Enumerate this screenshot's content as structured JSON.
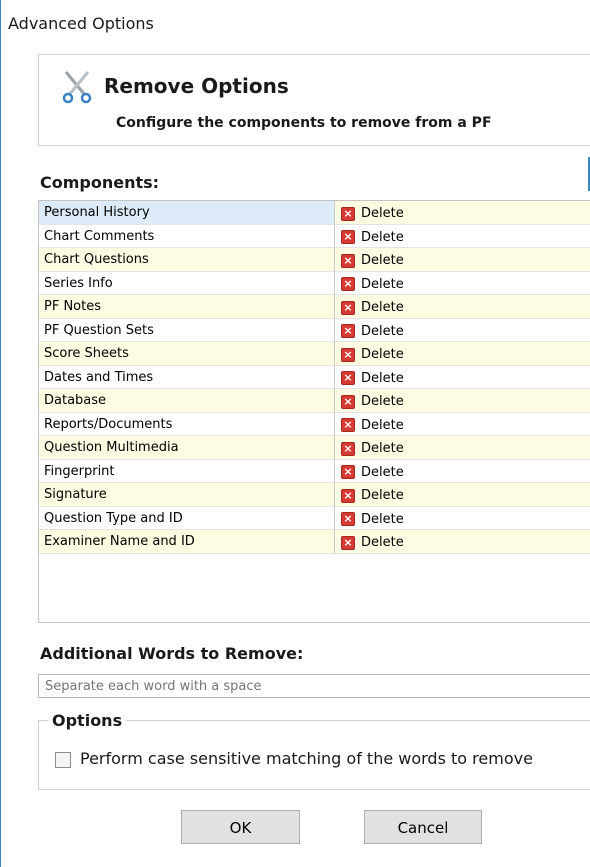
{
  "window": {
    "title": "Advanced Options"
  },
  "header": {
    "icon": "scissors-icon",
    "title": "Remove Options",
    "subtitle": "Configure the components to remove from a PF"
  },
  "components": {
    "heading": "Components:",
    "action_icon": "delete-x-icon",
    "items": [
      {
        "name": "Personal History",
        "action": "Delete"
      },
      {
        "name": "Chart Comments",
        "action": "Delete"
      },
      {
        "name": "Chart Questions",
        "action": "Delete"
      },
      {
        "name": "Series Info",
        "action": "Delete"
      },
      {
        "name": "PF Notes",
        "action": "Delete"
      },
      {
        "name": "PF Question Sets",
        "action": "Delete"
      },
      {
        "name": "Score Sheets",
        "action": "Delete"
      },
      {
        "name": "Dates and Times",
        "action": "Delete"
      },
      {
        "name": "Database",
        "action": "Delete"
      },
      {
        "name": "Reports/Documents",
        "action": "Delete"
      },
      {
        "name": "Question Multimedia",
        "action": "Delete"
      },
      {
        "name": "Fingerprint",
        "action": "Delete"
      },
      {
        "name": "Signature",
        "action": "Delete"
      },
      {
        "name": "Question Type and ID",
        "action": "Delete"
      },
      {
        "name": "Examiner Name and ID",
        "action": "Delete"
      }
    ]
  },
  "words": {
    "heading": "Additional Words to Remove:",
    "placeholder": "Separate each word with a space",
    "value": ""
  },
  "options": {
    "legend": "Options",
    "case_sensitive_label": "Perform case sensitive matching of the words to remove",
    "case_sensitive_checked": false
  },
  "buttons": {
    "ok": "OK",
    "cancel": "Cancel"
  }
}
